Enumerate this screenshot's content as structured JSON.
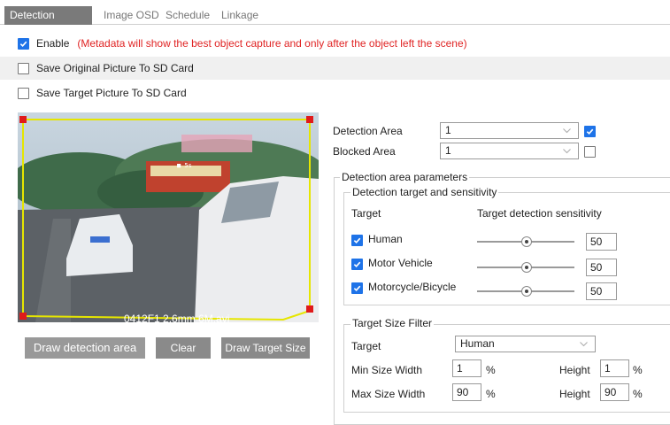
{
  "tabs": [
    {
      "label": "Detection Config",
      "active": true
    },
    {
      "label": "Image OSD",
      "active": false
    },
    {
      "label": "Schedule",
      "active": false
    },
    {
      "label": "Linkage",
      "active": false
    }
  ],
  "enable": {
    "label": "Enable",
    "checked": true,
    "note": "(Metadata will show the best object capture and only after the object left the scene)"
  },
  "save_original": {
    "label": "Save Original Picture To SD Card",
    "checked": false
  },
  "save_target": {
    "label": "Save Target Picture To SD Card",
    "checked": false
  },
  "video": {
    "overlay_text": "0412F1 2.6mm 6M.avi"
  },
  "buttons": {
    "draw_detection_area": "Draw detection area",
    "clear": "Clear",
    "draw_target_size": "Draw Target Size"
  },
  "detection_area": {
    "label": "Detection Area",
    "value": "1",
    "checked": true
  },
  "blocked_area": {
    "label": "Blocked Area",
    "value": "1",
    "checked": false
  },
  "params": {
    "title": "Detection area parameters",
    "target_group_title": "Detection target and sensitivity",
    "col_target": "Target",
    "col_sensitivity": "Target detection sensitivity",
    "targets": [
      {
        "label": "Human",
        "checked": true,
        "sensitivity": "50"
      },
      {
        "label": "Motor Vehicle",
        "checked": true,
        "sensitivity": "50"
      },
      {
        "label": "Motorcycle/Bicycle",
        "checked": true,
        "sensitivity": "50"
      }
    ]
  },
  "size_filter": {
    "title": "Target Size Filter",
    "target_label": "Target",
    "target_value": "Human",
    "min_width_label": "Min Size Width",
    "min_width": "1",
    "min_height_label": "Height",
    "min_height": "1",
    "max_width_label": "Max Size Width",
    "max_width": "90",
    "max_height_label": "Height",
    "max_height": "90",
    "unit": "%"
  },
  "colors": {
    "accent": "#1e73e8",
    "warning": "#e02424",
    "active_tab": "#7a7a7a"
  }
}
